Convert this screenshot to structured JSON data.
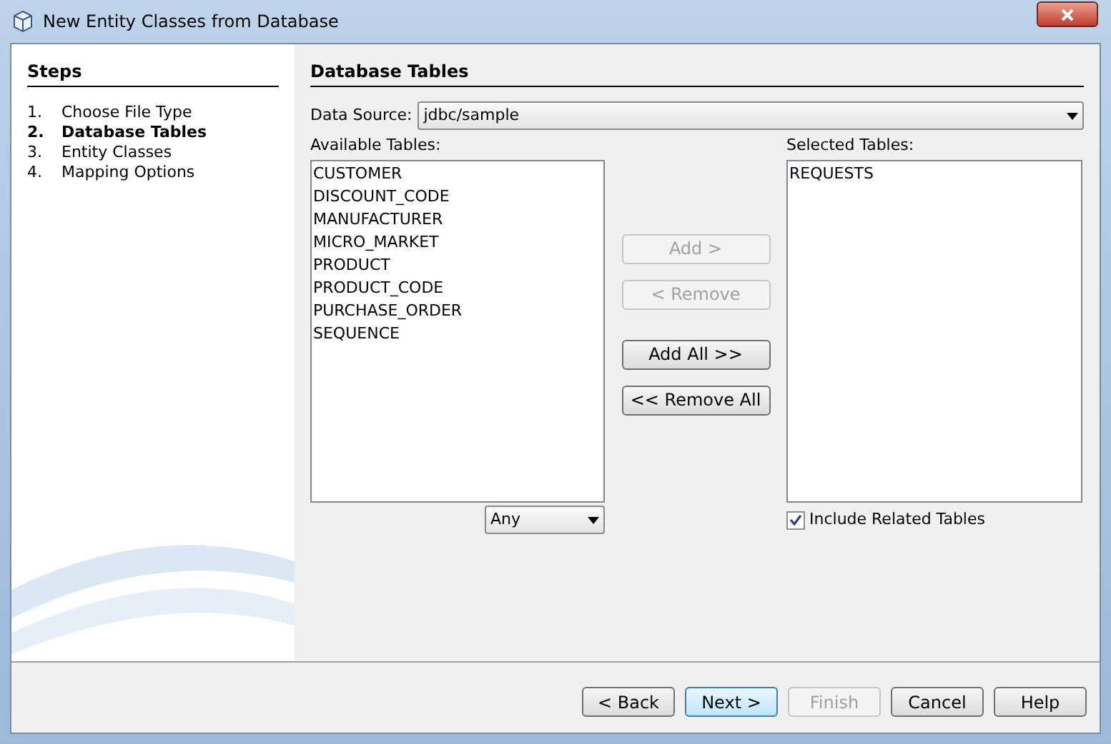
{
  "window": {
    "title": "New Entity Classes from Database"
  },
  "steps": {
    "title": "Steps",
    "items": [
      {
        "number": "1.",
        "label": "Choose File Type",
        "selected": false
      },
      {
        "number": "2.",
        "label": "Database Tables",
        "selected": true
      },
      {
        "number": "3.",
        "label": "Entity Classes",
        "selected": false
      },
      {
        "number": "4.",
        "label": "Mapping Options",
        "selected": false
      }
    ]
  },
  "panel": {
    "title": "Database Tables",
    "data_source": {
      "label": "Data Source:",
      "value": "jdbc/sample"
    },
    "available": {
      "label": "Available Tables:",
      "items": [
        "CUSTOMER",
        "DISCOUNT_CODE",
        "MANUFACTURER",
        "MICRO_MARKET",
        "PRODUCT",
        "PRODUCT_CODE",
        "PURCHASE_ORDER",
        "SEQUENCE"
      ],
      "filter": "Any"
    },
    "actions": [
      {
        "label": "Add >",
        "disabled": true
      },
      {
        "label": "< Remove",
        "disabled": true
      },
      {
        "label": "Add All >>",
        "disabled": false
      },
      {
        "label": "<< Remove All",
        "disabled": false
      }
    ],
    "selected": {
      "label": "Selected Tables:",
      "items": [
        "REQUESTS"
      ]
    },
    "include_related": {
      "label": "Include Related Tables",
      "checked": true
    }
  },
  "buttons": [
    {
      "label": "< Back",
      "disabled": false,
      "default": false
    },
    {
      "label": "Next >",
      "disabled": false,
      "default": true
    },
    {
      "label": "Finish",
      "disabled": true,
      "default": false
    },
    {
      "label": "Cancel",
      "disabled": false,
      "default": false
    },
    {
      "label": "Help",
      "disabled": false,
      "default": false
    }
  ]
}
